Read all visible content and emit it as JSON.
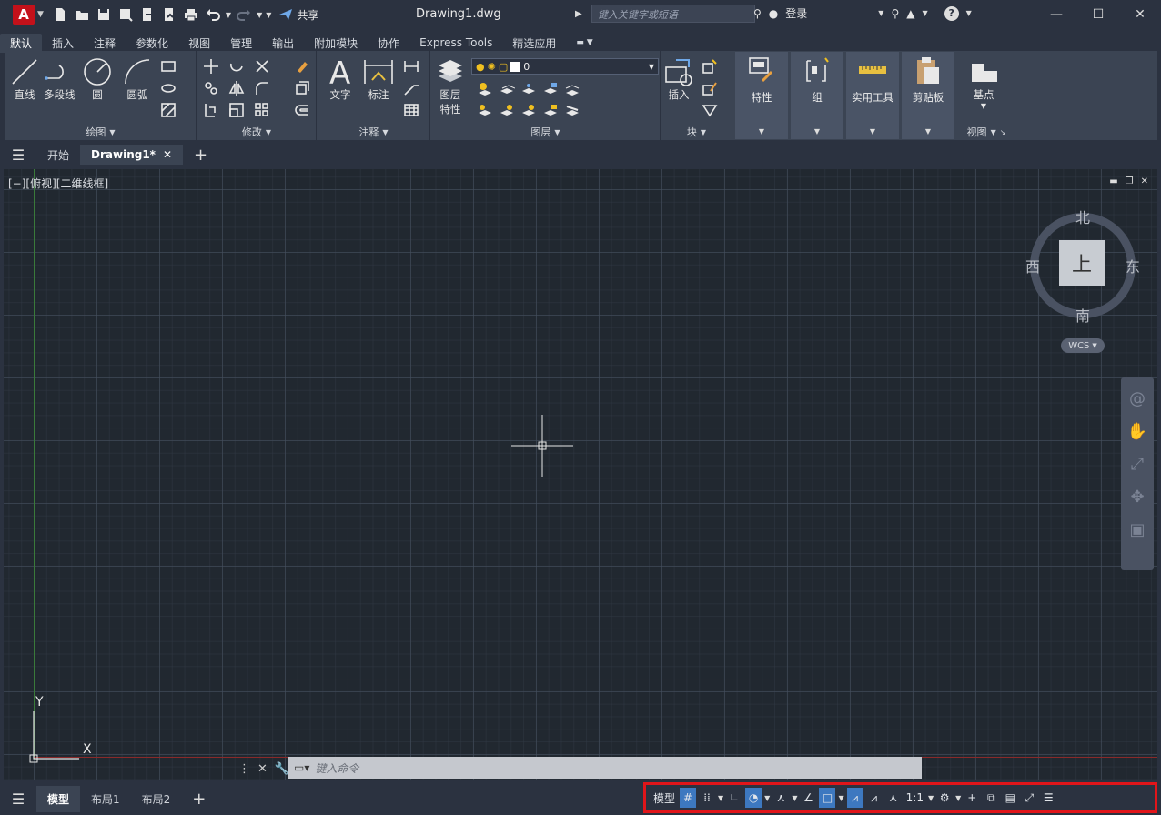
{
  "app": {
    "logo_letter": "A",
    "share_label": "共享",
    "doc_title": "Drawing1.dwg"
  },
  "search": {
    "placeholder": "键入关键字或短语"
  },
  "account": {
    "login_label": "登录"
  },
  "ribbon_tabs": [
    "默认",
    "插入",
    "注释",
    "参数化",
    "视图",
    "管理",
    "输出",
    "附加模块",
    "协作",
    "Express Tools",
    "精选应用"
  ],
  "ribbon": {
    "draw": {
      "title": "绘图",
      "line": "直线",
      "polyline": "多段线",
      "circle": "圆",
      "arc": "圆弧"
    },
    "modify": {
      "title": "修改"
    },
    "annotation": {
      "title": "注释",
      "text": "文字",
      "dimension": "标注"
    },
    "layers": {
      "title": "图层",
      "layer_props_1": "图层",
      "layer_props_2": "特性",
      "current_layer": "0"
    },
    "block": {
      "title": "块",
      "insert": "插入"
    },
    "properties": {
      "label": "特性"
    },
    "groups": {
      "label": "组"
    },
    "utilities": {
      "label": "实用工具"
    },
    "clipboard": {
      "label": "剪贴板"
    },
    "view": {
      "title": "视图",
      "base": "基点"
    }
  },
  "file_tabs": {
    "start": "开始",
    "drawing": "Drawing1*"
  },
  "viewport": {
    "label": "[−][俯视][二维线框]",
    "viewcube": {
      "north": "北",
      "south": "南",
      "east": "东",
      "west": "西",
      "face": "上",
      "wcs": "WCS"
    },
    "ucs": {
      "x": "X",
      "y": "Y"
    }
  },
  "command": {
    "placeholder": "键入命令"
  },
  "layout_tabs": [
    "模型",
    "布局1",
    "布局2"
  ],
  "status": {
    "model": "模型",
    "scale": "1:1"
  },
  "colors": {
    "accent": "#3d78c0",
    "highlight_border": "#e0151a",
    "logo": "#c4111a"
  }
}
